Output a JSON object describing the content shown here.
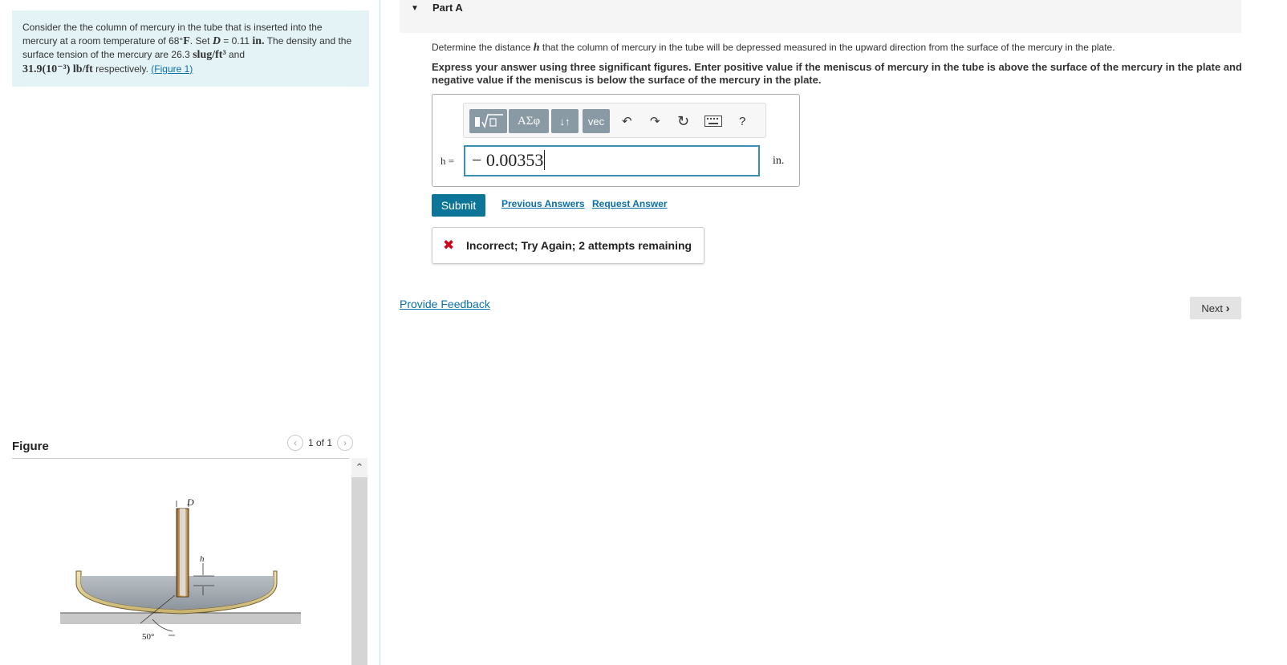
{
  "problem": {
    "t1": "Consider the the column of mercury in the tube that is inserted into the mercury at a room temperature of 68",
    "deg": "°",
    "unit_F": "F",
    "t2": ". Set ",
    "var_D": "D",
    "t3": " = 0.11 ",
    "unit_in": "in.",
    "t4": " The density and the surface tension of the mercury are 26.3 ",
    "unit_density": "slug/ft³",
    "t5": " and",
    "tension_value": "31.9(10⁻³) lb/ft",
    "t6": " respectively. ",
    "figure_link": "(Figure 1)"
  },
  "figure_panel": {
    "title": "Figure",
    "pager": "1 of 1",
    "labels": {
      "D": "D",
      "h": "h",
      "angle": "50°"
    }
  },
  "part": {
    "label": "Part A"
  },
  "question": {
    "prompt_before": "Determine the distance ",
    "prompt_var": "h",
    "prompt_after": " that the column of mercury in the tube will be depressed measured in the upward direction from the surface of the mercury in the plate.",
    "instructions": "Express your answer using three significant figures. Enter positive value if the meniscus of mercury in the tube is above the surface of the mercury in the plate and negative value if the meniscus is below the surface of the mercury in the plate."
  },
  "toolbar": {
    "greek_label": "ΑΣφ",
    "sort_label": "↓↑",
    "vec_label": "vec",
    "help_label": "?"
  },
  "answer": {
    "var_label": "h =",
    "value": "− 0.00353",
    "unit": "in."
  },
  "actions": {
    "submit": "Submit",
    "previous_answers": "Previous Answers",
    "request_answer": "Request Answer"
  },
  "feedback": {
    "icon": "close-icon",
    "message": "Incorrect; Try Again; 2 attempts remaining",
    "color": "#d0021b"
  },
  "footer": {
    "provide_feedback": "Provide Feedback",
    "next": "Next"
  },
  "colors": {
    "accent": "#0d7597",
    "link": "#0b70a8",
    "problem_bg": "#e3f3f6"
  }
}
